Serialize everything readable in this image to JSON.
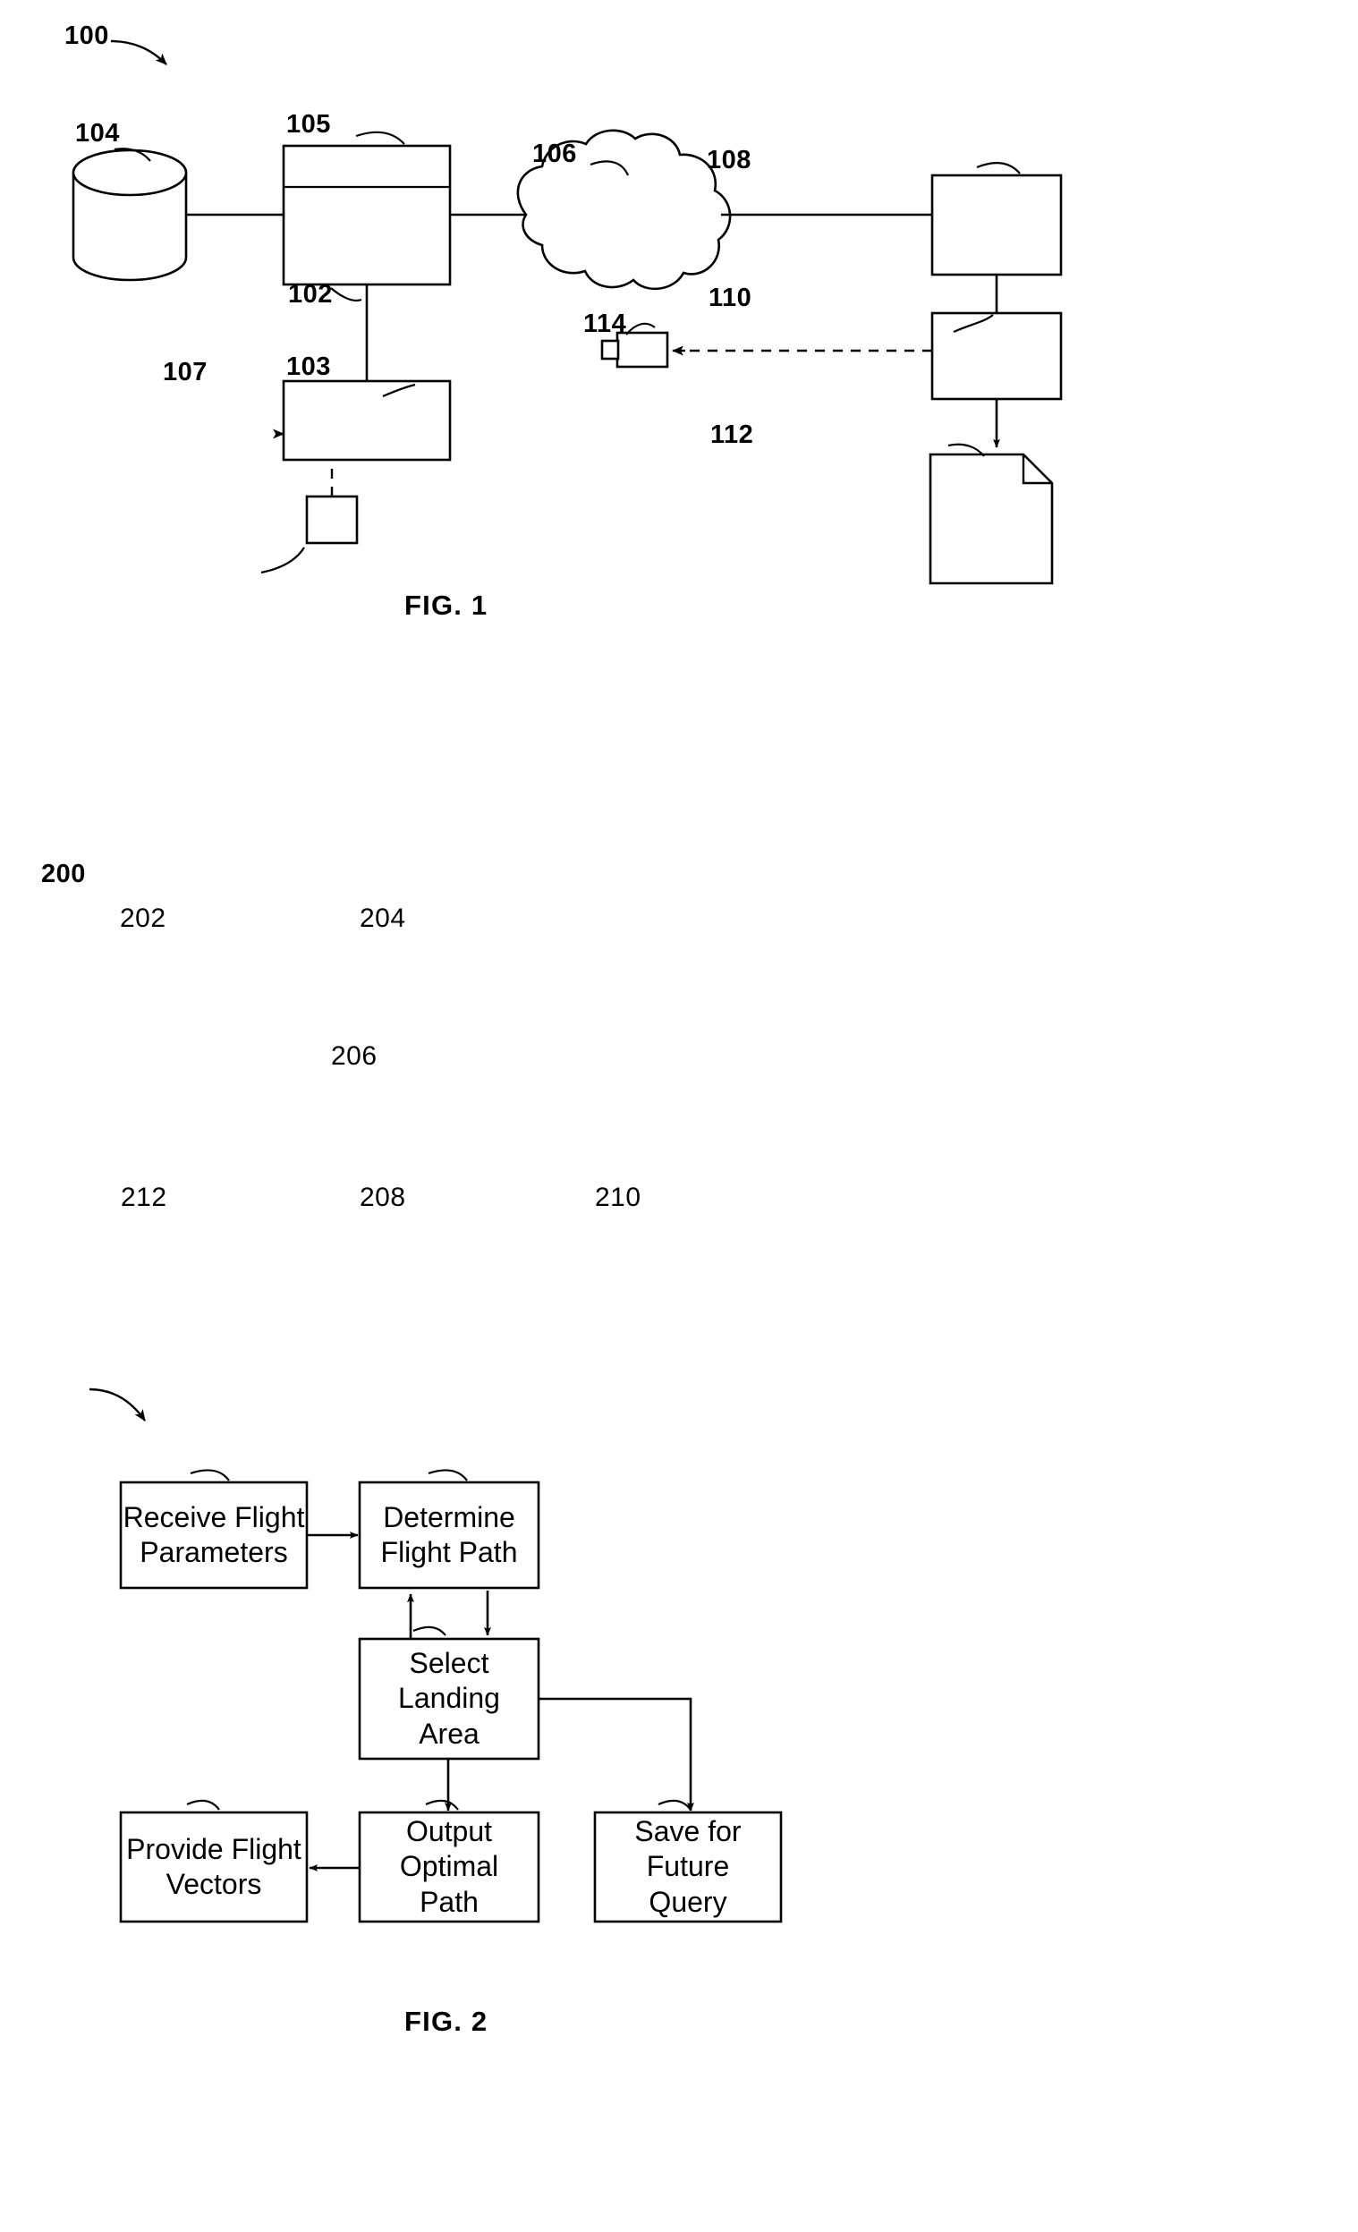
{
  "document": {
    "type": "patent-figure-sheet",
    "figures": [
      {
        "id": "fig1",
        "caption": "FIG. 1",
        "system_number": "100",
        "elements": [
          {
            "ref": "104",
            "kind": "database-cylinder",
            "label": ""
          },
          {
            "ref": "105",
            "kind": "rectangle-top-section",
            "label": ""
          },
          {
            "ref": "102",
            "kind": "rectangle-main",
            "label": ""
          },
          {
            "ref": "103",
            "kind": "rectangle",
            "label": ""
          },
          {
            "ref": "107",
            "kind": "small-square",
            "label": ""
          },
          {
            "ref": "106",
            "kind": "cloud-network",
            "label": ""
          },
          {
            "ref": "108",
            "kind": "rectangle",
            "label": ""
          },
          {
            "ref": "110",
            "kind": "rectangle",
            "label": ""
          },
          {
            "ref": "112",
            "kind": "document-page",
            "label": ""
          },
          {
            "ref": "114",
            "kind": "camera-device",
            "label": ""
          }
        ]
      },
      {
        "id": "fig2",
        "caption": "FIG. 2",
        "system_number": "200",
        "elements": [
          {
            "ref": "202",
            "kind": "process-box",
            "label": "Receive Flight Parameters"
          },
          {
            "ref": "204",
            "kind": "process-box",
            "label": "Determine Flight Path"
          },
          {
            "ref": "206",
            "kind": "process-box",
            "label": "Select Landing Area"
          },
          {
            "ref": "208",
            "kind": "process-box",
            "label": "Output Optimal Path"
          },
          {
            "ref": "210",
            "kind": "process-box",
            "label": "Save for Future Query"
          },
          {
            "ref": "212",
            "kind": "process-box",
            "label": "Provide Flight Vectors"
          }
        ]
      }
    ]
  },
  "fig1": {
    "caption": "FIG. 1",
    "refs": {
      "r100": "100",
      "r102": "102",
      "r103": "103",
      "r104": "104",
      "r105": "105",
      "r106": "106",
      "r107": "107",
      "r108": "108",
      "r110": "110",
      "r112": "112",
      "r114": "114"
    }
  },
  "fig2": {
    "caption": "FIG. 2",
    "refs": {
      "r200": "200",
      "r202": "202",
      "r204": "204",
      "r206": "206",
      "r208": "208",
      "r210": "210",
      "r212": "212"
    },
    "boxes": {
      "b202_line1": "Receive Flight",
      "b202_line2": "Parameters",
      "b204_line1": "Determine",
      "b204_line2": "Flight Path",
      "b206_line1": "Select Landing",
      "b206_line2": "Area",
      "b208_line1": "Output Optimal",
      "b208_line2": "Path",
      "b210_line1": "Save for Future",
      "b210_line2": "Query",
      "b212_line1": "Provide Flight",
      "b212_line2": "Vectors"
    }
  },
  "style": {
    "stroke": "#000000",
    "fill": "#ffffff",
    "background": "#ffffff"
  }
}
